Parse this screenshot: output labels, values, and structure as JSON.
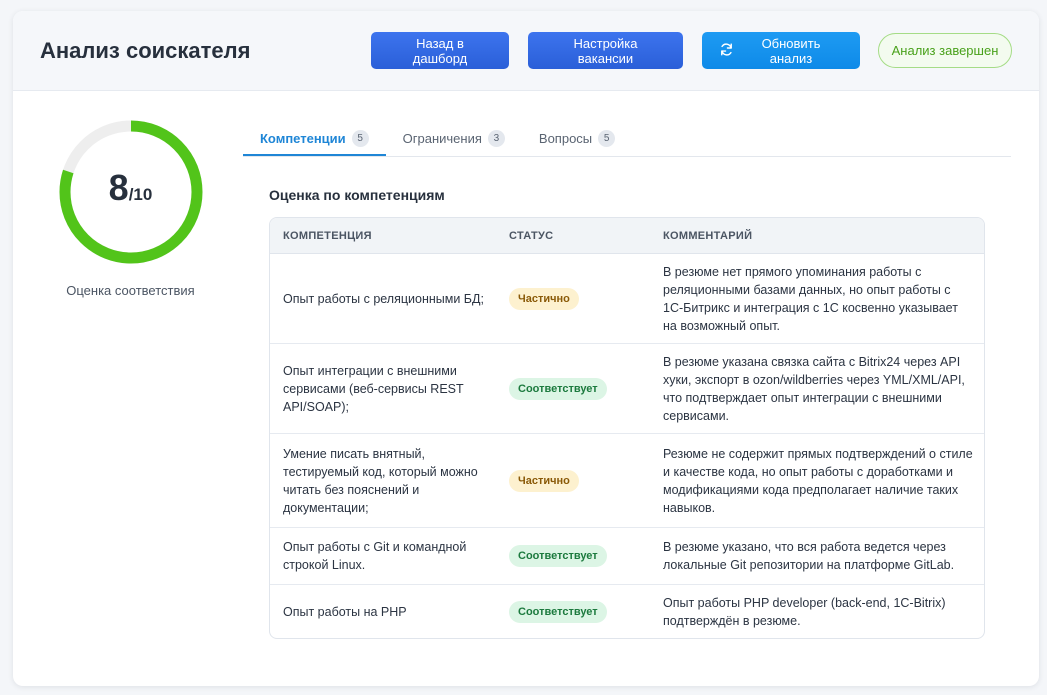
{
  "header": {
    "title": "Анализ соискателя",
    "buttons": {
      "dashboard": "Назад в дашборд",
      "vacancy": "Настройка вакансии",
      "refresh": "Обновить анализ"
    },
    "status_badge": "Анализ завершен"
  },
  "score": {
    "value": "8",
    "max": "/10",
    "fraction": 0.8,
    "label": "Оценка соответствия",
    "color": "#52c41a"
  },
  "tabs": [
    {
      "label": "Компетенции",
      "count": "5"
    },
    {
      "label": "Ограничения",
      "count": "3"
    },
    {
      "label": "Вопросы",
      "count": "5"
    }
  ],
  "section_title": "Оценка по компетенциям",
  "table": {
    "headers": [
      "КОМПЕТЕНЦИЯ",
      "СТАТУС",
      "КОММЕНТАРИЙ"
    ],
    "rows": [
      {
        "competency": "Опыт работы с реляционными БД;",
        "status": "Частично",
        "status_type": "partial",
        "comment": "В резюме нет прямого упоминания работы с реляционными базами данных, но опыт работы с 1С-Битрикс и интеграция с 1С косвенно указывает на возможный опыт."
      },
      {
        "competency": "Опыт интеграции с внешними сервисами (веб-сервисы REST API/SOAP);",
        "status": "Соответствует",
        "status_type": "ok",
        "comment": "В резюме указана связка сайта с Bitrix24 через API хуки, экспорт в ozon/wildberries через YML/XML/API, что подтверждает опыт интеграции с внешними сервисами."
      },
      {
        "competency": "Умение писать внятный, тестируемый код, который можно читать без пояснений и документации;",
        "status": "Частично",
        "status_type": "partial",
        "comment": "Резюме не содержит прямых подтверждений о стиле и качестве кода, но опыт работы с доработками и модификациями кода предполагает наличие таких навыков."
      },
      {
        "competency": "Опыт работы с Git и командной строкой Linux.",
        "status": "Соответствует",
        "status_type": "ok",
        "comment": "В резюме указано, что вся работа ведется через локальные Git репозитории на платформе GitLab."
      },
      {
        "competency": "Опыт работы на PHP",
        "status": "Соответствует",
        "status_type": "ok",
        "comment": "Опыт работы PHP developer (back-end, 1C-Bitrix) подтверждён в резюме."
      }
    ]
  }
}
